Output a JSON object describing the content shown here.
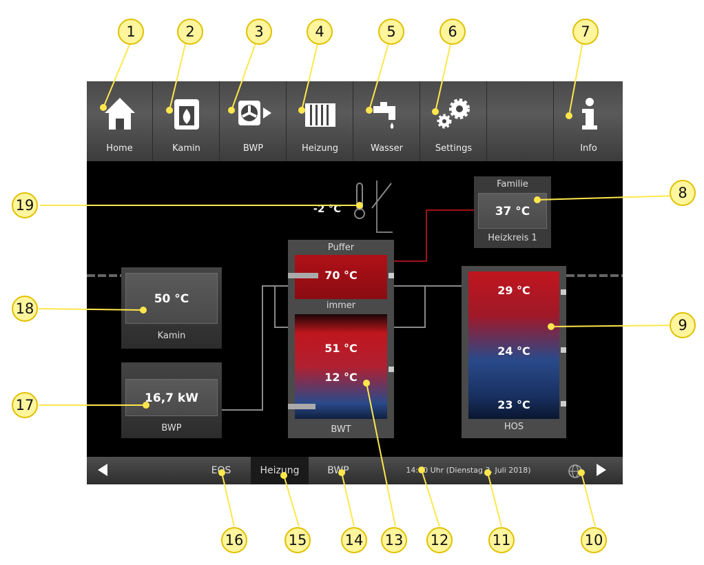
{
  "nav": {
    "items": [
      {
        "label": "Home",
        "icon": "home-icon"
      },
      {
        "label": "Kamin",
        "icon": "fireplace-icon"
      },
      {
        "label": "BWP",
        "icon": "heat-pump-icon"
      },
      {
        "label": "Heizung",
        "icon": "radiator-icon"
      },
      {
        "label": "Wasser",
        "icon": "faucet-icon"
      },
      {
        "label": "Settings",
        "icon": "gears-icon"
      },
      {
        "label": "",
        "icon": ""
      },
      {
        "label": "Info",
        "icon": "info-icon"
      }
    ]
  },
  "outdoor": {
    "temp": "-2 °C"
  },
  "heizkreis": {
    "top_label": "Familie",
    "temp": "37 °C",
    "caption": "Heizkreis 1"
  },
  "puffer": {
    "title": "Puffer",
    "temp": "70 °C",
    "mode": "immer"
  },
  "bwt": {
    "temp_top": "51 °C",
    "temp_bottom": "12 °C",
    "caption": "BWT"
  },
  "hos": {
    "temp_top": "29 °C",
    "temp_mid": "24 °C",
    "temp_bottom": "23 °C",
    "caption": "HOS"
  },
  "kamin": {
    "temp": "50 °C",
    "caption": "Kamin"
  },
  "bwp": {
    "power": "16,7 kW",
    "caption": "BWP"
  },
  "bottom": {
    "tabs": [
      "EOS",
      "Heizung",
      "BWP"
    ],
    "datetime": "14:30 Uhr (Dienstag 3. Juli 2018)"
  },
  "colors": {
    "callout": "#fff59d",
    "hot": "#c0161e",
    "cold": "#1e3f78"
  },
  "callouts": [
    "1",
    "2",
    "3",
    "4",
    "5",
    "6",
    "7",
    "8",
    "9",
    "10",
    "11",
    "12",
    "13",
    "14",
    "15",
    "16",
    "17",
    "18",
    "19"
  ]
}
